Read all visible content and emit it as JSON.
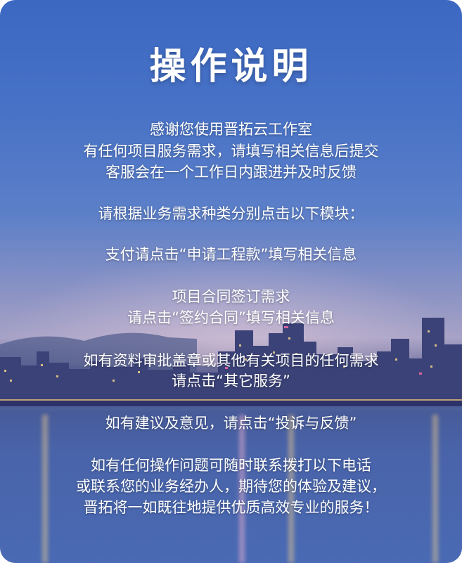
{
  "title": "操作说明",
  "lines": [
    "感谢您使用晋拓云工作室",
    "有任何项目服务需求，请填写相关信息后提交",
    "客服会在一个工作日内跟进并及时反馈",
    "请根据业务需求种类分别点击以下模块：",
    "支付请点击“申请工程款”填写相关信息",
    "项目合同签订需求",
    "请点击“签约合同”填写相关信息",
    "如有资料审批盖章或其他有关项目的任何需求",
    "请点击“其它服务”",
    "如有建议及意见，请点击“投诉与反馈”",
    "如有任何操作问题可随时联系拨打以下电话",
    "或联系您的业务经办人，期待您的体验及建议，",
    "晋拓将一如既往地提供优质高效专业的服务！"
  ]
}
